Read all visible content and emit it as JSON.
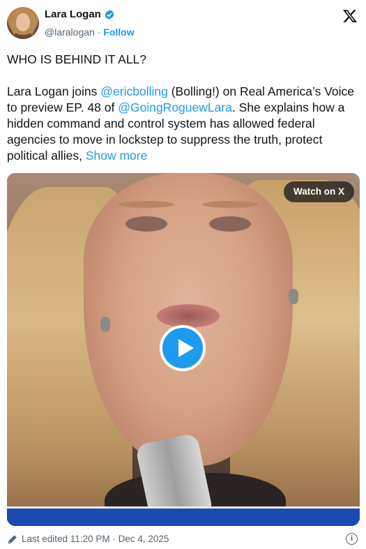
{
  "author": {
    "name": "Lara Logan",
    "handle": "@laralogan",
    "separator": "·",
    "follow_label": "Follow"
  },
  "icons": {
    "verified": "verified-badge-icon",
    "platform": "x-logo-icon",
    "edit": "pencil-icon",
    "info": "info-icon",
    "play": "play-icon"
  },
  "post": {
    "headline": "WHO IS BEHIND IT ALL?",
    "body_part1": "Lara Logan joins ",
    "mention1": "@ericbolling",
    "body_part2": " (Bolling!) on Real America’s Voice to preview EP. 48 of ",
    "mention2": "@GoingRoguewLara",
    "body_part3": ". She explains how a hidden command and control system has allowed federal agencies to move in lockstep to suppress the truth, protect political allies, ",
    "show_more": "Show more"
  },
  "media": {
    "watch_label": "Watch on X"
  },
  "footer": {
    "edited_text": "Last edited 11:20 PM · Dec 4, 2025",
    "info_glyph": "i"
  },
  "colors": {
    "link": "#1d9bf0",
    "text": "#0f1419",
    "muted": "#536471",
    "play": "#1d9bf0"
  }
}
